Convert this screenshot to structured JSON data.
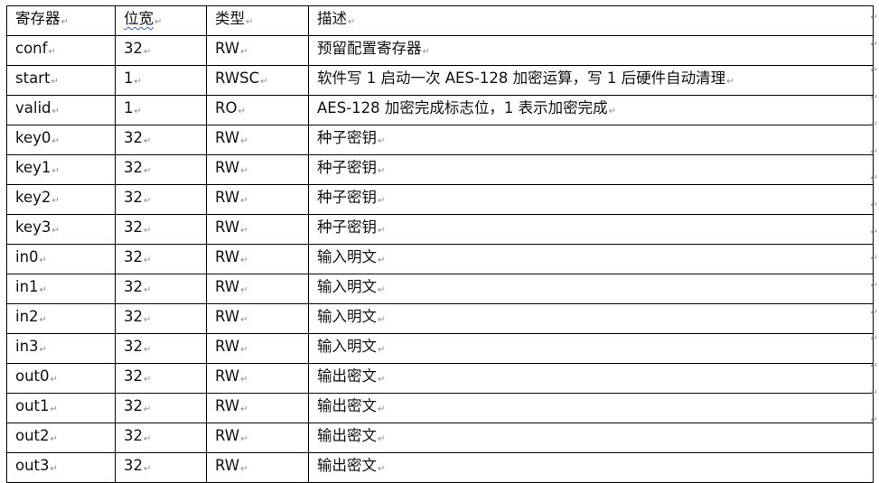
{
  "table": {
    "headers": [
      "寄存器",
      "位宽",
      "类型",
      "描述"
    ],
    "rows": [
      [
        "conf",
        "32",
        "RW",
        "预留配置寄存器"
      ],
      [
        "start",
        "1",
        "RWSC",
        "软件写 1 启动一次 AES-128 加密运算，写 1 后硬件自动清理"
      ],
      [
        "valid",
        "1",
        "RO",
        "AES-128 加密完成标志位，1 表示加密完成"
      ],
      [
        "key0",
        "32",
        "RW",
        "种子密钥"
      ],
      [
        "key1",
        "32",
        "RW",
        "种子密钥"
      ],
      [
        "key2",
        "32",
        "RW",
        "种子密钥"
      ],
      [
        "key3",
        "32",
        "RW",
        "种子密钥"
      ],
      [
        "in0",
        "32",
        "RW",
        "输入明文"
      ],
      [
        "in1",
        "32",
        "RW",
        "输入明文"
      ],
      [
        "in2",
        "32",
        "RW",
        "输入明文"
      ],
      [
        "in3",
        "32",
        "RW",
        "输入明文"
      ],
      [
        "out0",
        "32",
        "RW",
        "输出密文"
      ],
      [
        "out1",
        "32",
        "RW",
        "输出密文"
      ],
      [
        "out2",
        "32",
        "RW",
        "输出密文"
      ],
      [
        "out3",
        "32",
        "RW",
        "输出密文"
      ]
    ]
  },
  "marks": {
    "cell_end": "↵"
  }
}
